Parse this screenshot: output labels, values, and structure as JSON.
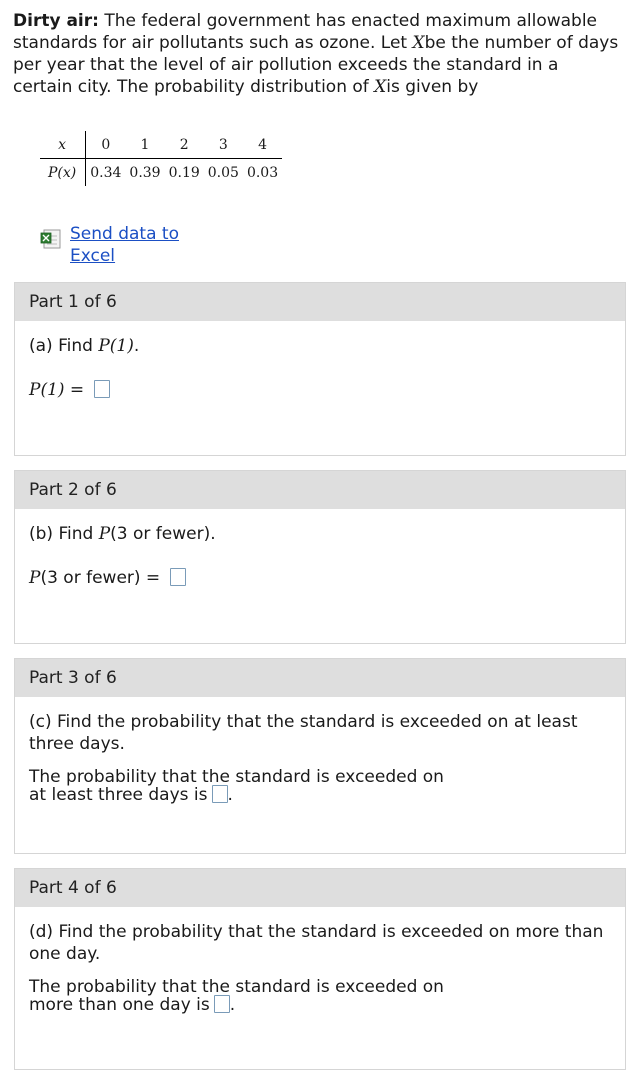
{
  "intro": {
    "bold": "Dirty air:",
    "t1": " The federal government has enacted maximum allowable standards for air pollutants such as ozone. Let ",
    "var1": "X",
    "t2": "be the number of days per year that the level of air pollution exceeds the standard in a certain city. The probability distribution of ",
    "var2": "X",
    "t3": "is given by"
  },
  "table": {
    "row1_head": "x",
    "row2_head": "P(x)",
    "x": [
      "0",
      "1",
      "2",
      "3",
      "4"
    ],
    "p": [
      "0.34",
      "0.39",
      "0.19",
      "0.05",
      "0.03"
    ]
  },
  "excel_link": "Send data to Excel",
  "parts": [
    {
      "header": "Part 1 of 6",
      "question_prefix": "(a) Find ",
      "question_math": "P(1)",
      "question_suffix": ".",
      "answer_math": "P(1)",
      "answer_suffix": " ="
    },
    {
      "header": "Part 2 of 6",
      "question_prefix": "(b) Find ",
      "question_math": "P",
      "question_suffix": "(3 or fewer).",
      "answer_math": "P",
      "answer_suffix": "(3 or fewer)  ="
    },
    {
      "header": "Part 3 of 6",
      "question": "(c) Find the probability that the standard is exceeded on at least three days.",
      "answer_line1": "The probability that the standard is exceeded on",
      "answer_line2": "at least three days is"
    },
    {
      "header": "Part 4 of 6",
      "question": "(d) Find the probability that the standard is exceeded on more than one day.",
      "answer_line1": "The probability that the standard is exceeded on",
      "answer_line2": "more than one day is"
    }
  ]
}
